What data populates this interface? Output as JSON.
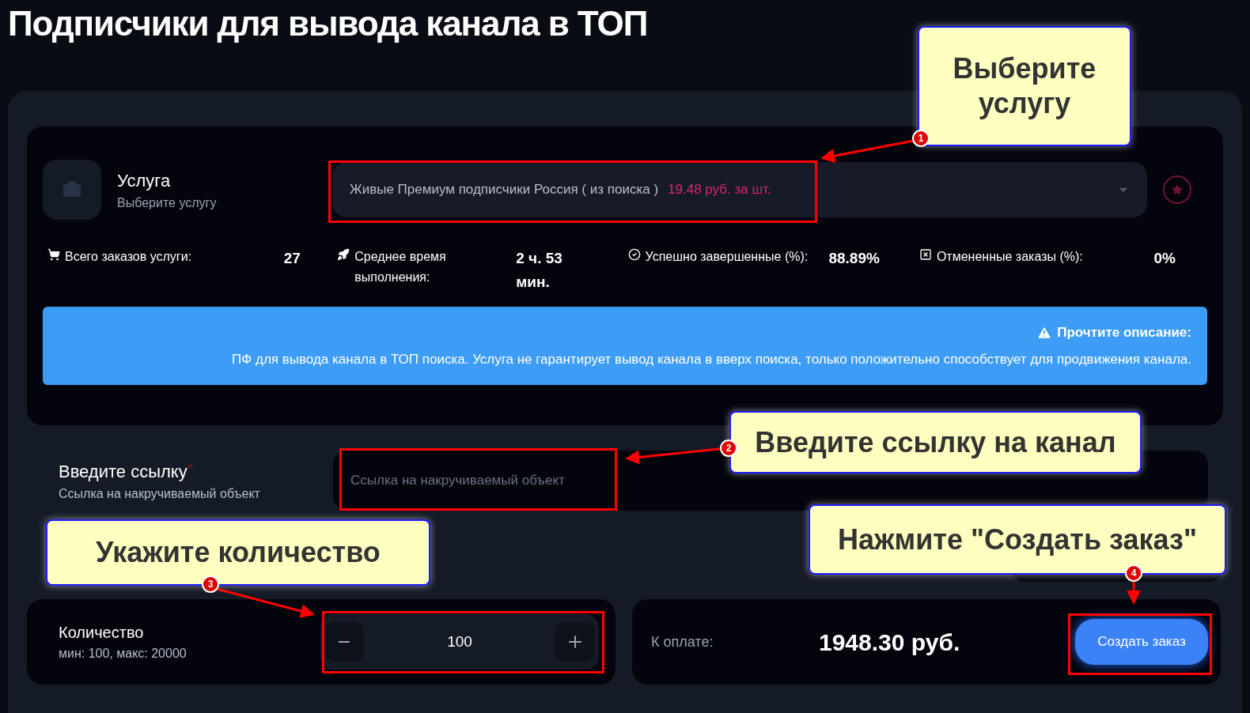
{
  "title": "Подписчики для вывода канала в ТОП",
  "service": {
    "label": "Услуга",
    "hint": "Выберите услугу",
    "selected_value": "Живые Премиум подписчики Россия ( из поиска )",
    "price": "19.48 руб. за шт."
  },
  "stats": [
    {
      "kind": "cart",
      "label": "Всего заказов услуги:",
      "value": "27"
    },
    {
      "kind": "rocket",
      "label": "Среднее время выполнения:",
      "value": "2 ч. 53 мин."
    },
    {
      "kind": "check",
      "label": "Успешно завершенные (%):",
      "value": "88.89%"
    },
    {
      "kind": "cancel",
      "label": "Отмененные заказы (%):",
      "value": "0%"
    }
  ],
  "alert": {
    "title": "Прочтите описание:",
    "text": "ПФ для вывода канала в ТОП поиска. Услуга не гарантирует вывод канала в вверх поиска, только положительно способствует для продвижения канала."
  },
  "link_field": {
    "label": "Введите ссылку",
    "required_mark": "*",
    "hint": "Ссылка на накручиваемый объект",
    "placeholder": "Ссылка на накручиваемый объект"
  },
  "quantity": {
    "label": "Количество",
    "range": "мин: 100, макс: 20000",
    "value": "100"
  },
  "payment": {
    "label": "К оплате:",
    "amount": "1948.30 руб.",
    "button": "Создать заказ"
  },
  "annotations": [
    {
      "number": "1",
      "text": "Выберите услугу"
    },
    {
      "number": "2",
      "text": "Введите ссылку на канал"
    },
    {
      "number": "3",
      "text": "Укажите количество"
    },
    {
      "number": "4",
      "text": "Нажмите \"Создать заказ\""
    }
  ]
}
